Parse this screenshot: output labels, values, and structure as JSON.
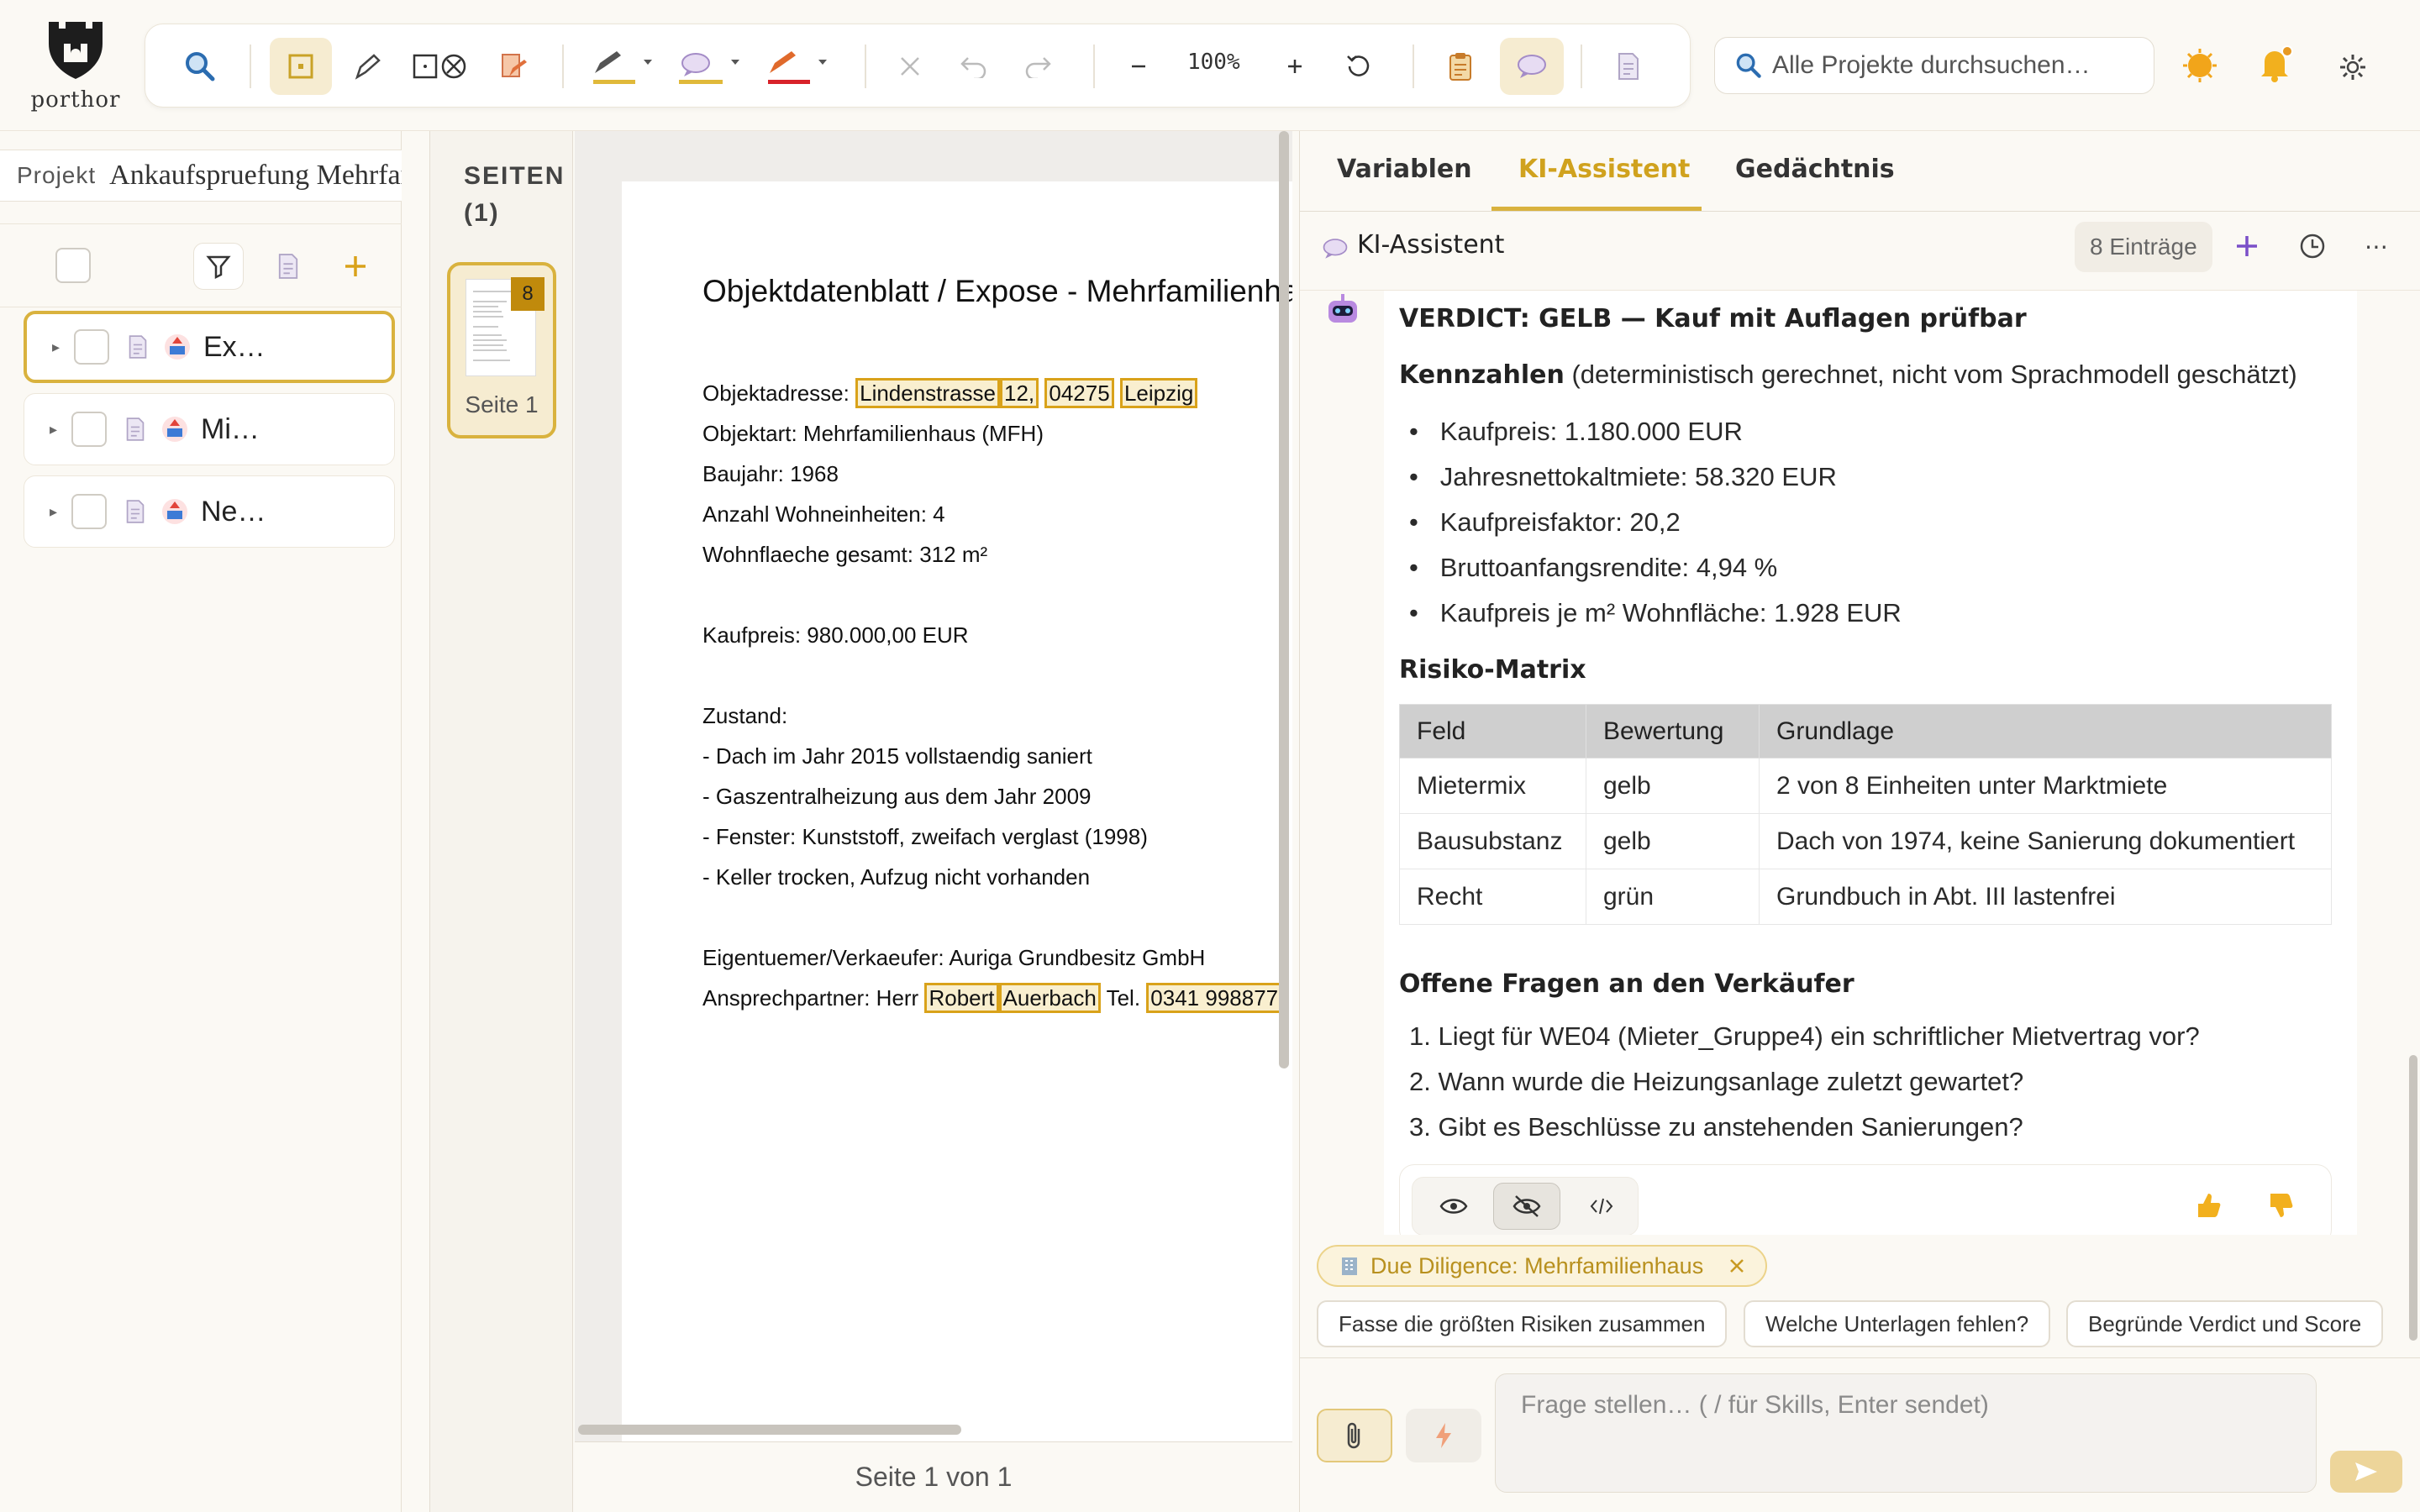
{
  "app": {
    "logo_text": "porthor"
  },
  "toolbar": {
    "zoom": "100%",
    "items": [
      "search-icon",
      "select-icon",
      "pen-icon",
      "shape-redact-icon",
      "draw-icon",
      "highlight-pen-icon",
      "comment-bubble-icon",
      "red-pen-icon",
      "clear-icon",
      "undo-icon",
      "redo-icon",
      "zoom-out-icon",
      "zoom-in-icon",
      "rotate-icon",
      "clipboard-icon",
      "chat-icon",
      "document-icon"
    ]
  },
  "search": {
    "placeholder": "Alle Projekte durchsuchen…"
  },
  "sidebar": {
    "project_label": "Projekt",
    "project_name": "Ankaufspruefung Mehrfamilienhaus",
    "items": [
      {
        "name": "Ex…",
        "selected": true
      },
      {
        "name": "Mi…",
        "selected": false
      },
      {
        "name": "Ne…",
        "selected": false
      }
    ]
  },
  "pages": {
    "title_line1": "SEITEN",
    "title_line2": "(1)",
    "thumb_label": "Seite 1",
    "badge": "8",
    "footer": "Seite 1 von 1"
  },
  "document": {
    "title": "Objektdatenblatt / Expose - Mehrfamilienhaus",
    "address_label": "Objektadresse:",
    "address_street": "Lindenstrasse",
    "address_no": "12,",
    "address_zip": "04275",
    "address_city": "Leipzig",
    "type": "Objektart: Mehrfamilienhaus (MFH)",
    "year": "Baujahr: 1968",
    "units": "Anzahl Wohneinheiten: 4",
    "area": "Wohnflaeche gesamt: 312 m²",
    "price": "Kaufpreis: 980.000,00 EUR",
    "condition_label": "Zustand:",
    "condition_1": "- Dach im Jahr 2015 vollstaendig saniert",
    "condition_2": "- Gaszentralheizung aus dem Jahr 2009",
    "condition_3": "- Fenster: Kunststoff, zweifach verglast (1998)",
    "condition_4": "- Keller trocken, Aufzug nicht vorhanden",
    "owner": "Eigentuemer/Verkaeufer: Auriga Grundbesitz GmbH",
    "contact_label": "Ansprechpartner: Herr",
    "contact_first": "Robert",
    "contact_last": "Auerbach",
    "tel_label": "Tel.",
    "tel": "0341 998877"
  },
  "panel": {
    "tabs": [
      "Variablen",
      "KI-Assistent",
      "Gedächtnis"
    ],
    "active_tab": 1,
    "title": "KI-Assistent",
    "count": "8 Einträge"
  },
  "message": {
    "verdict": "VERDICT: GELB — Kauf mit Auflagen prüfbar",
    "kpi_head": "Kennzahlen",
    "kpi_note": " (deterministisch gerechnet, nicht vom Sprachmodell geschätzt)",
    "kpis": [
      "Kaufpreis: 1.180.000 EUR",
      "Jahresnettokaltmiete: 58.320 EUR",
      "Kaufpreisfaktor: 20,2",
      "Bruttoanfangsrendite: 4,94 %",
      "Kaufpreis je m² Wohnfläche: 1.928 EUR"
    ],
    "risk_head": "Risiko-Matrix",
    "risk_cols": [
      "Feld",
      "Bewertung",
      "Grundlage"
    ],
    "risk_rows": [
      [
        "Mietermix",
        "gelb",
        "2 von 8 Einheiten unter Marktmiete"
      ],
      [
        "Bausubstanz",
        "gelb",
        "Dach von 1974, keine Sanierung dokumentiert"
      ],
      [
        "Recht",
        "grün",
        "Grundbuch in Abt. III lastenfrei"
      ]
    ],
    "questions_head": "Offene Fragen an den Verkäufer",
    "questions": [
      "1. Liegt für WE04 (Mieter_Gruppe4) ein schriftlicher Mietvertrag vor?",
      "2. Wann wurde die Heizungsanlage zuletzt gewartet?",
      "3. Gibt es Beschlüsse zu anstehenden Sanierungen?"
    ]
  },
  "skill_chip": "Due Diligence: Mehrfamilienhaus",
  "suggestions": [
    "Fasse die größten Risiken zusammen",
    "Welche Unterlagen fehlen?",
    "Begründe Verdict und Score"
  ],
  "composer": {
    "placeholder": "Frage stellen… ( / für Skills, Enter sendet)"
  },
  "colors": {
    "accent": "#d9b23e",
    "accent_bg": "#f6ecd1",
    "highlight": "#d9a21a"
  }
}
